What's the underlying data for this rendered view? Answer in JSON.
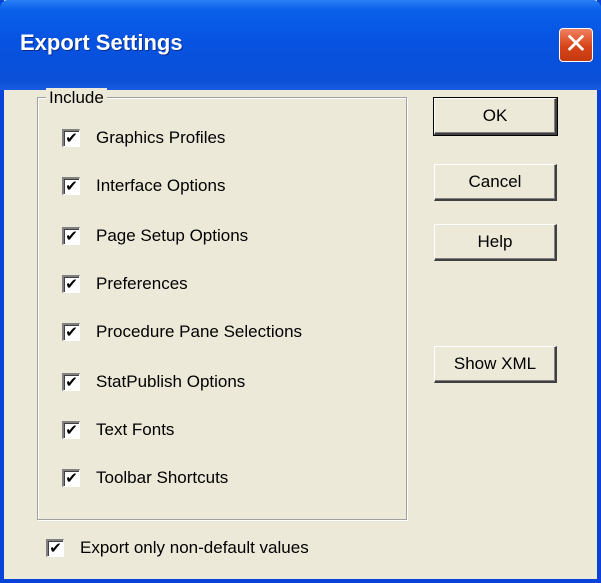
{
  "dialog": {
    "title": "Export Settings",
    "close_glyph": "✕"
  },
  "include_group": {
    "label": "Include",
    "items": [
      {
        "label": "Graphics Profiles",
        "checked": true
      },
      {
        "label": "Interface Options",
        "checked": true
      },
      {
        "label": "Page Setup Options",
        "checked": true
      },
      {
        "label": "Preferences",
        "checked": true
      },
      {
        "label": "Procedure Pane Selections",
        "checked": true
      },
      {
        "label": "StatPublish Options",
        "checked": true
      },
      {
        "label": "Text Fonts",
        "checked": true
      },
      {
        "label": "Toolbar Shortcuts",
        "checked": true
      }
    ]
  },
  "export_non_default": {
    "label": "Export only non-default values",
    "checked": true
  },
  "buttons": {
    "ok": "OK",
    "cancel": "Cancel",
    "help": "Help",
    "show_xml": "Show XML"
  },
  "check_glyph": "✔",
  "colors": {
    "titlebar": "#0752e0",
    "dialog_bg": "#ece9d8",
    "close_button": "#d84418"
  }
}
